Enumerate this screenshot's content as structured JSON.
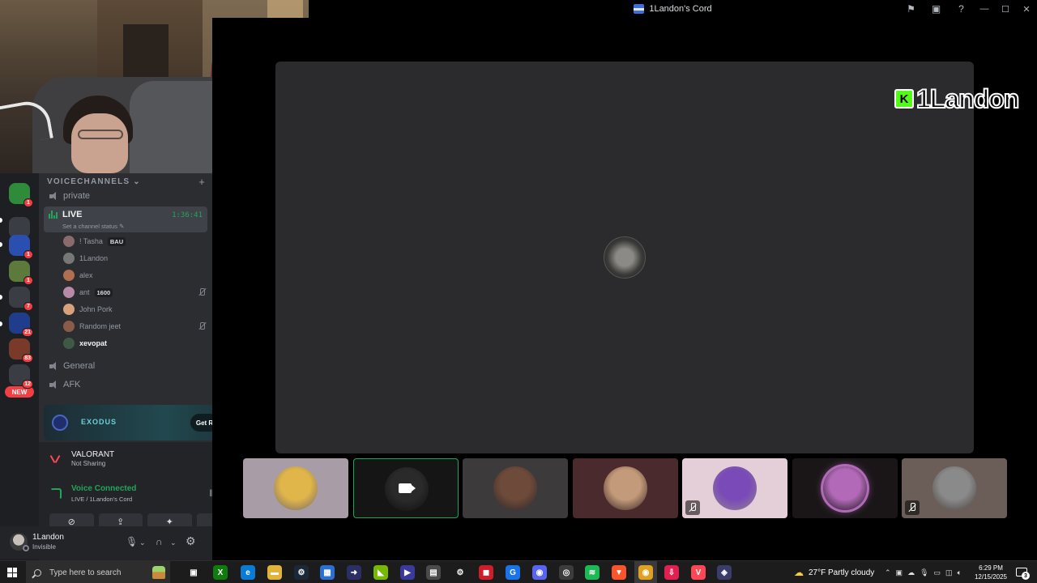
{
  "window": {
    "title": "1Landon's Cord",
    "actions": [
      "inbox-icon",
      "help-icon"
    ],
    "controls": [
      "minimize-icon",
      "maximize-icon",
      "close-icon"
    ]
  },
  "overlay": {
    "brand_text": "1Landon",
    "brand_letter": "K",
    "brand_color": "#53fc18"
  },
  "guilds": [
    {
      "badge": "1",
      "color": "#2f8a3a"
    },
    {
      "badge": "",
      "color": "#3b3d44"
    },
    {
      "badge": "1",
      "color": "#2a4fb0"
    },
    {
      "badge": "1",
      "color": "#5b7a3c"
    },
    {
      "badge": "7",
      "color": "#3b3d44"
    },
    {
      "badge": "21",
      "color": "#1f3d8a"
    },
    {
      "badge": "83",
      "color": "#7a3a2a"
    },
    {
      "badge": "12",
      "color": "#3b3d44"
    }
  ],
  "new_badge": "NEW",
  "sidebar": {
    "category": "VOICECHANNELS",
    "channels_top": [
      "private"
    ],
    "live": {
      "name": "LIVE",
      "timer": "1:36:41",
      "status": "Set a channel status"
    },
    "members": [
      {
        "name": "! Tasha",
        "tag": "BAU",
        "muted": false,
        "color": "#8a6b6b"
      },
      {
        "name": "1Landon",
        "tag": "",
        "muted": false,
        "color": "#777"
      },
      {
        "name": "alex",
        "tag": "",
        "muted": false,
        "color": "#b07050"
      },
      {
        "name": "ant",
        "tag": "1600",
        "muted": true,
        "color": "#b98aa8"
      },
      {
        "name": "John Pork",
        "tag": "",
        "muted": false,
        "color": "#d7a27a"
      },
      {
        "name": "Random jeet",
        "tag": "",
        "muted": true,
        "color": "#8a5a4a"
      },
      {
        "name": "xevopat",
        "tag": "",
        "muted": false,
        "color": "#3e5a44"
      }
    ],
    "channels_bottom": [
      "General",
      "AFK"
    ]
  },
  "promo": {
    "name": "EXODUS",
    "button": "Get Reward!"
  },
  "activity": {
    "title": "VALORANT",
    "subtitle": "Not Sharing"
  },
  "voice": {
    "title": "Voice Connected",
    "subtitle": "LIVE / 1Landon's Cord",
    "buttons": [
      "camera-off-icon",
      "screen-share-icon",
      "activities-icon",
      "soundboard-icon"
    ]
  },
  "user": {
    "name": "1Landon",
    "status": "Invisible"
  },
  "tiles": [
    {
      "bg": "#a89ca6",
      "avatar": "#e0b54a",
      "muted": false,
      "active": false,
      "camera": false
    },
    {
      "bg": "#151515",
      "avatar": "#2a2a2a",
      "muted": false,
      "active": true,
      "camera": true
    },
    {
      "bg": "#3c3a3a",
      "avatar": "#6e4a3a",
      "muted": false,
      "active": false,
      "camera": false
    },
    {
      "bg": "#4a2a2c",
      "avatar": "#c39a7a",
      "muted": false,
      "active": false,
      "camera": false
    },
    {
      "bg": "#e4cfd8",
      "avatar": "#7a4ab8",
      "muted": true,
      "active": false,
      "camera": false
    },
    {
      "bg": "#1a1618",
      "avatar": "#b26ab8",
      "muted": false,
      "active": false,
      "camera": false
    },
    {
      "bg": "#6b5e58",
      "avatar": "#8a8a8a",
      "muted": true,
      "active": false,
      "camera": false
    }
  ],
  "taskbar": {
    "search_placeholder": "Type here to search",
    "weather": "27°F  Partly cloudy",
    "time": "6:29 PM",
    "date": "12/15/2025",
    "notifications": "3",
    "apps": [
      {
        "name": "task-view-icon",
        "color": "#1c1c1c",
        "glyph": "▣"
      },
      {
        "name": "xbox-icon",
        "color": "#107c10",
        "glyph": "X"
      },
      {
        "name": "edge-icon",
        "color": "#0a7cd6",
        "glyph": "e"
      },
      {
        "name": "file-explorer-icon",
        "color": "#e0b43a",
        "glyph": "▬"
      },
      {
        "name": "steam-icon",
        "color": "#1b2838",
        "glyph": "⚙"
      },
      {
        "name": "store-icon",
        "color": "#2b6fd0",
        "glyph": "▦"
      },
      {
        "name": "app-icon",
        "color": "#2c2f66",
        "glyph": "➜"
      },
      {
        "name": "nvidia-icon",
        "color": "#76b900",
        "glyph": "◣"
      },
      {
        "name": "media-icon",
        "color": "#3a3a9a",
        "glyph": "▶"
      },
      {
        "name": "calculator-icon",
        "color": "#4a4a4a",
        "glyph": "▤"
      },
      {
        "name": "settings-icon",
        "color": "#1c1c1c",
        "glyph": "⚙"
      },
      {
        "name": "red-app-icon",
        "color": "#d11c2a",
        "glyph": "◼"
      },
      {
        "name": "g-app-icon",
        "color": "#1a73e8",
        "glyph": "G"
      },
      {
        "name": "discord-icon",
        "color": "#5865f2",
        "glyph": "◉"
      },
      {
        "name": "chrome-alt-icon",
        "color": "#3c3c3c",
        "glyph": "◎"
      },
      {
        "name": "spotify-icon",
        "color": "#1db954",
        "glyph": "≋"
      },
      {
        "name": "brave-icon",
        "color": "#fb542b",
        "glyph": "▼"
      },
      {
        "name": "chrome-icon",
        "color": "#e0a020",
        "glyph": "◉"
      },
      {
        "name": "download-app-icon",
        "color": "#e02050",
        "glyph": "⇩"
      },
      {
        "name": "valorant-icon",
        "color": "#ff4655",
        "glyph": "V"
      },
      {
        "name": "shield-icon",
        "color": "#3c3c6a",
        "glyph": "◈"
      }
    ]
  }
}
